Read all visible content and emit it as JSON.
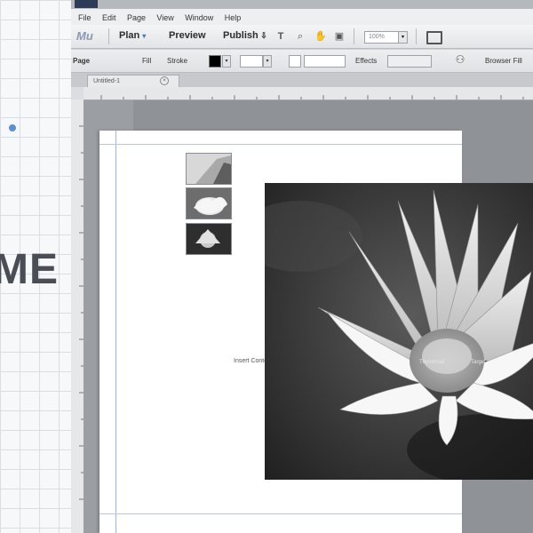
{
  "slide": {
    "word": "ME"
  },
  "app": {
    "badge": "",
    "menu": [
      "File",
      "Edit",
      "Page",
      "View",
      "Window",
      "Help"
    ],
    "toolbar": {
      "logo": "Mu",
      "plan": "Plan",
      "preview": "Preview",
      "publish": "Publish",
      "zoom": "100%"
    },
    "props": {
      "page": "Page",
      "fill": "Fill",
      "stroke": "Stroke",
      "effects": "Effects",
      "browser_fill": "Browser Fill"
    },
    "tab": {
      "label": "Untitled-1"
    },
    "image_caption": "Insert Content",
    "hotspots": [
      "Thumbnail",
      "Target"
    ]
  }
}
